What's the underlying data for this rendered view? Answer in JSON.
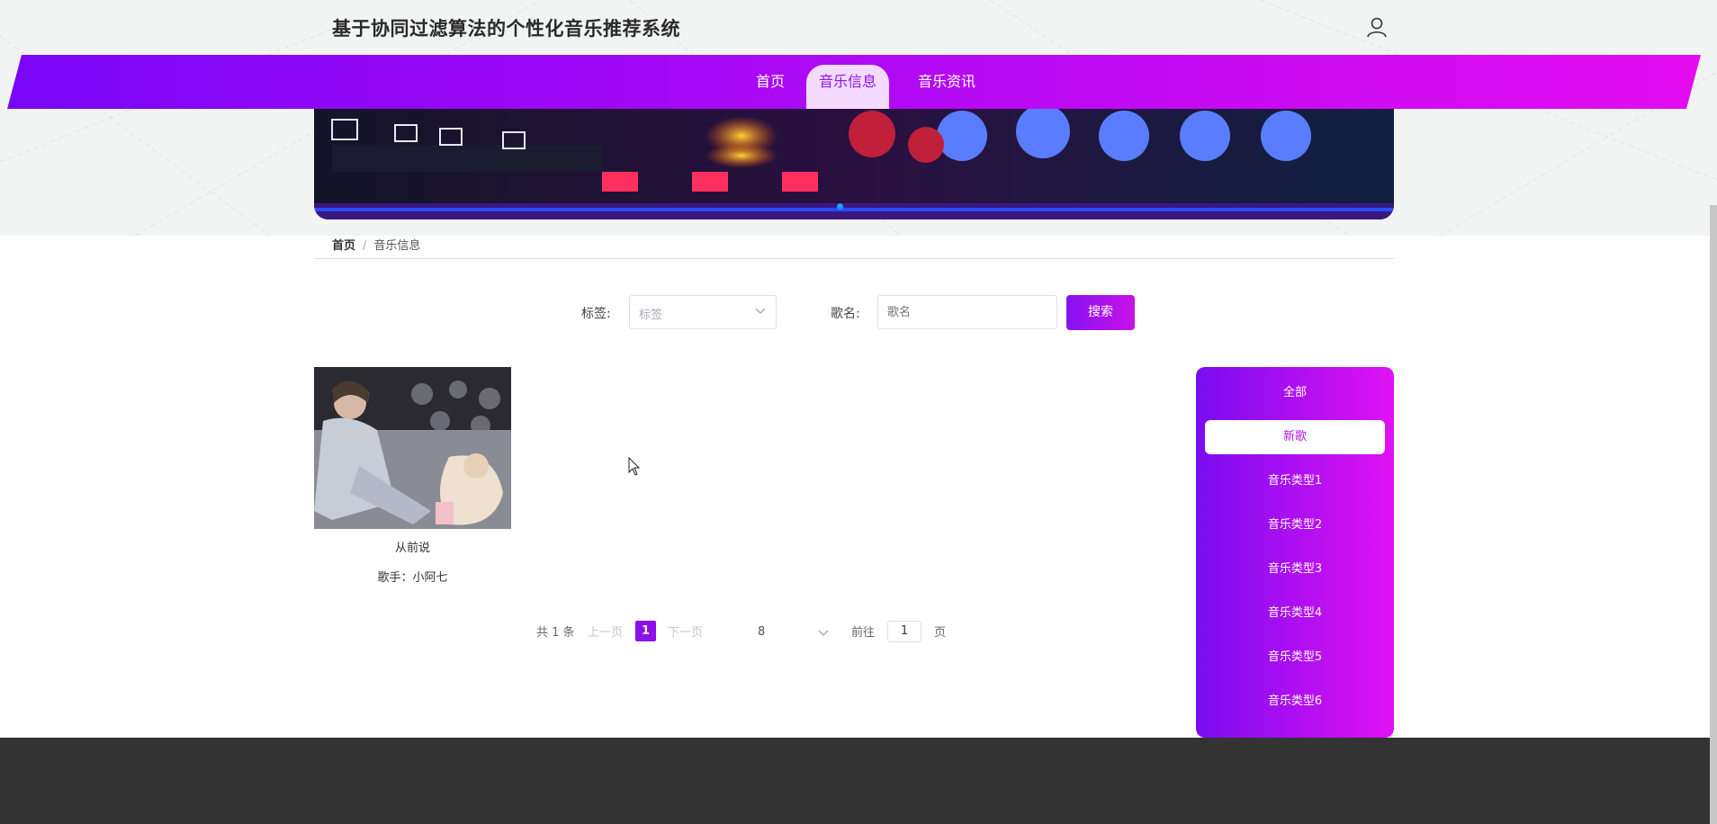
{
  "site": {
    "title": "基于协同过滤算法的个性化音乐推荐系统"
  },
  "nav": {
    "items": [
      {
        "label": "首页",
        "active": false
      },
      {
        "label": "音乐信息",
        "active": true
      },
      {
        "label": "音乐资讯",
        "active": false
      }
    ]
  },
  "breadcrumb": {
    "home": "首页",
    "sep": "/",
    "current": "音乐信息"
  },
  "filters": {
    "tag_label": "标签:",
    "tag_placeholder": "标签",
    "name_label": "歌名:",
    "name_placeholder": "歌名",
    "search_button": "搜索"
  },
  "songs": [
    {
      "name": "从前说",
      "singer": "歌手：小阿七"
    }
  ],
  "pagination": {
    "total": "共 1 条",
    "prev": "上一页",
    "current": "1",
    "next": "下一页",
    "page_size": "8",
    "goto_label": "前往",
    "goto_value": "1",
    "page_unit": "页"
  },
  "sidebar": {
    "items": [
      {
        "label": "全部",
        "active": false
      },
      {
        "label": "新歌",
        "active": true
      },
      {
        "label": "音乐类型1",
        "active": false
      },
      {
        "label": "音乐类型2",
        "active": false
      },
      {
        "label": "音乐类型3",
        "active": false
      },
      {
        "label": "音乐类型4",
        "active": false
      },
      {
        "label": "音乐类型5",
        "active": false
      },
      {
        "label": "音乐类型6",
        "active": false
      }
    ]
  },
  "colors": {
    "accent": "#8d0fe9",
    "accent2": "#e012f2",
    "footer": "#333333"
  },
  "icons": {
    "user": "user-icon",
    "chevron": "chevron-down-icon"
  }
}
